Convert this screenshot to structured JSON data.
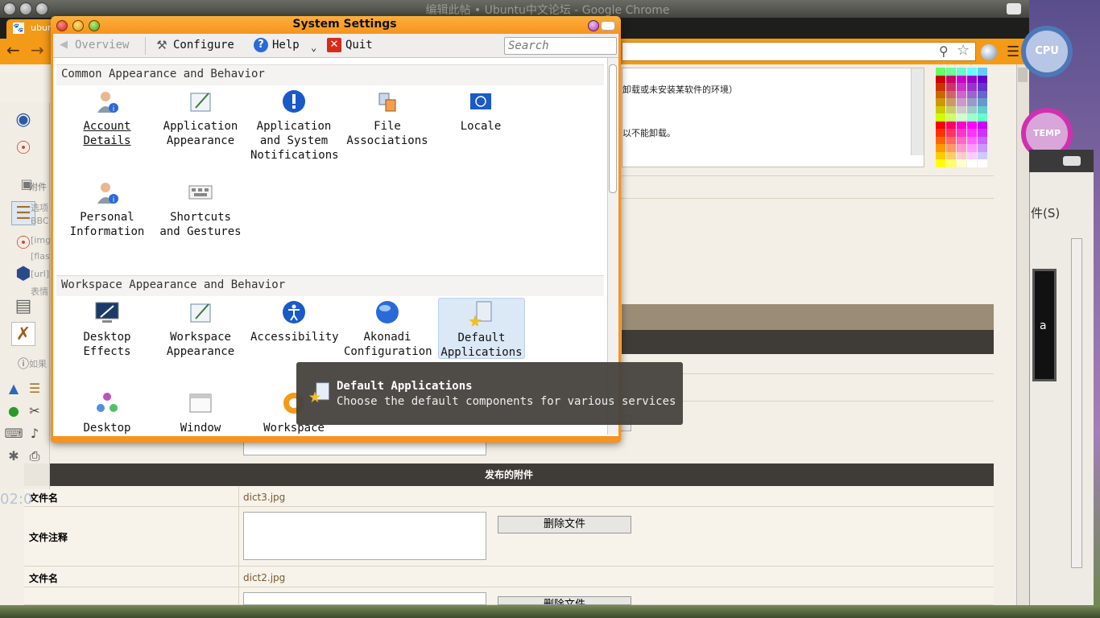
{
  "chrome": {
    "window_title": "编辑此帖 • Ubuntu中文论坛 - Google Chrome",
    "tab_label": "ubun",
    "tab_favicon": "🐾",
    "editor_lines": [
      "卸载或未安装某软件的环境）",
      "以不能卸载。"
    ]
  },
  "system_settings": {
    "title": "System Settings",
    "toolbar": {
      "overview": "Overview",
      "configure": "Configure",
      "help": "Help",
      "quit": "Quit",
      "search_placeholder": "Search"
    },
    "sections": [
      {
        "title": "Common Appearance and Behavior",
        "items": [
          {
            "label": "Account Details",
            "icon": "user-icon"
          },
          {
            "label": "Application Appearance",
            "icon": "appearance-icon"
          },
          {
            "label": "Application and System Notifications",
            "icon": "notifications-icon"
          },
          {
            "label": "File Associations",
            "icon": "file-associations-icon"
          },
          {
            "label": "Locale",
            "icon": "locale-icon"
          },
          {
            "label": "Personal Information",
            "icon": "user-icon"
          },
          {
            "label": "Shortcuts and Gestures",
            "icon": "keyboard-icon"
          }
        ]
      },
      {
        "title": "Workspace Appearance and Behavior",
        "items": [
          {
            "label": "Desktop Effects",
            "icon": "desktop-effects-icon"
          },
          {
            "label": "Workspace Appearance",
            "icon": "appearance-icon"
          },
          {
            "label": "Accessibility",
            "icon": "accessibility-icon"
          },
          {
            "label": "Akonadi Configuration",
            "icon": "akonadi-icon"
          },
          {
            "label": "Default Applications",
            "icon": "default-applications-icon"
          },
          {
            "label": "Desktop",
            "icon": "desktop-icon"
          },
          {
            "label": "Window",
            "icon": "window-icon"
          },
          {
            "label": "Workspace",
            "icon": "workspace-icon"
          }
        ]
      }
    ],
    "tooltip": {
      "title": "Default Applications",
      "description": "Choose the default components for various services"
    }
  },
  "attachments": {
    "header": "发布的附件",
    "filename_label": "文件名",
    "comment_label": "文件注释",
    "delete_label": "删除文件",
    "files": [
      "dict3.jpg",
      "dict2.jpg"
    ]
  },
  "dock": {
    "items": [
      "fedora-icon",
      "chrome-icon",
      "attach",
      "book-icon",
      "chrome-icon",
      "virtualbox-icon",
      "display-icon",
      "tools-icon",
      "help-icon"
    ],
    "bg_texts": [
      "附件",
      "选项",
      "BBC",
      "[img]",
      "[flas",
      "[url]",
      "表情",
      "如果"
    ],
    "time": "02:0"
  },
  "widgets": {
    "cpu_label": "CPU",
    "temp_label": "TEMP",
    "panel_label": "件(S)",
    "panel_black_text": "a"
  },
  "colors": {
    "accent": "#f7931e",
    "header_dark": "#3f3b36",
    "selected": "#dbe8f6"
  }
}
